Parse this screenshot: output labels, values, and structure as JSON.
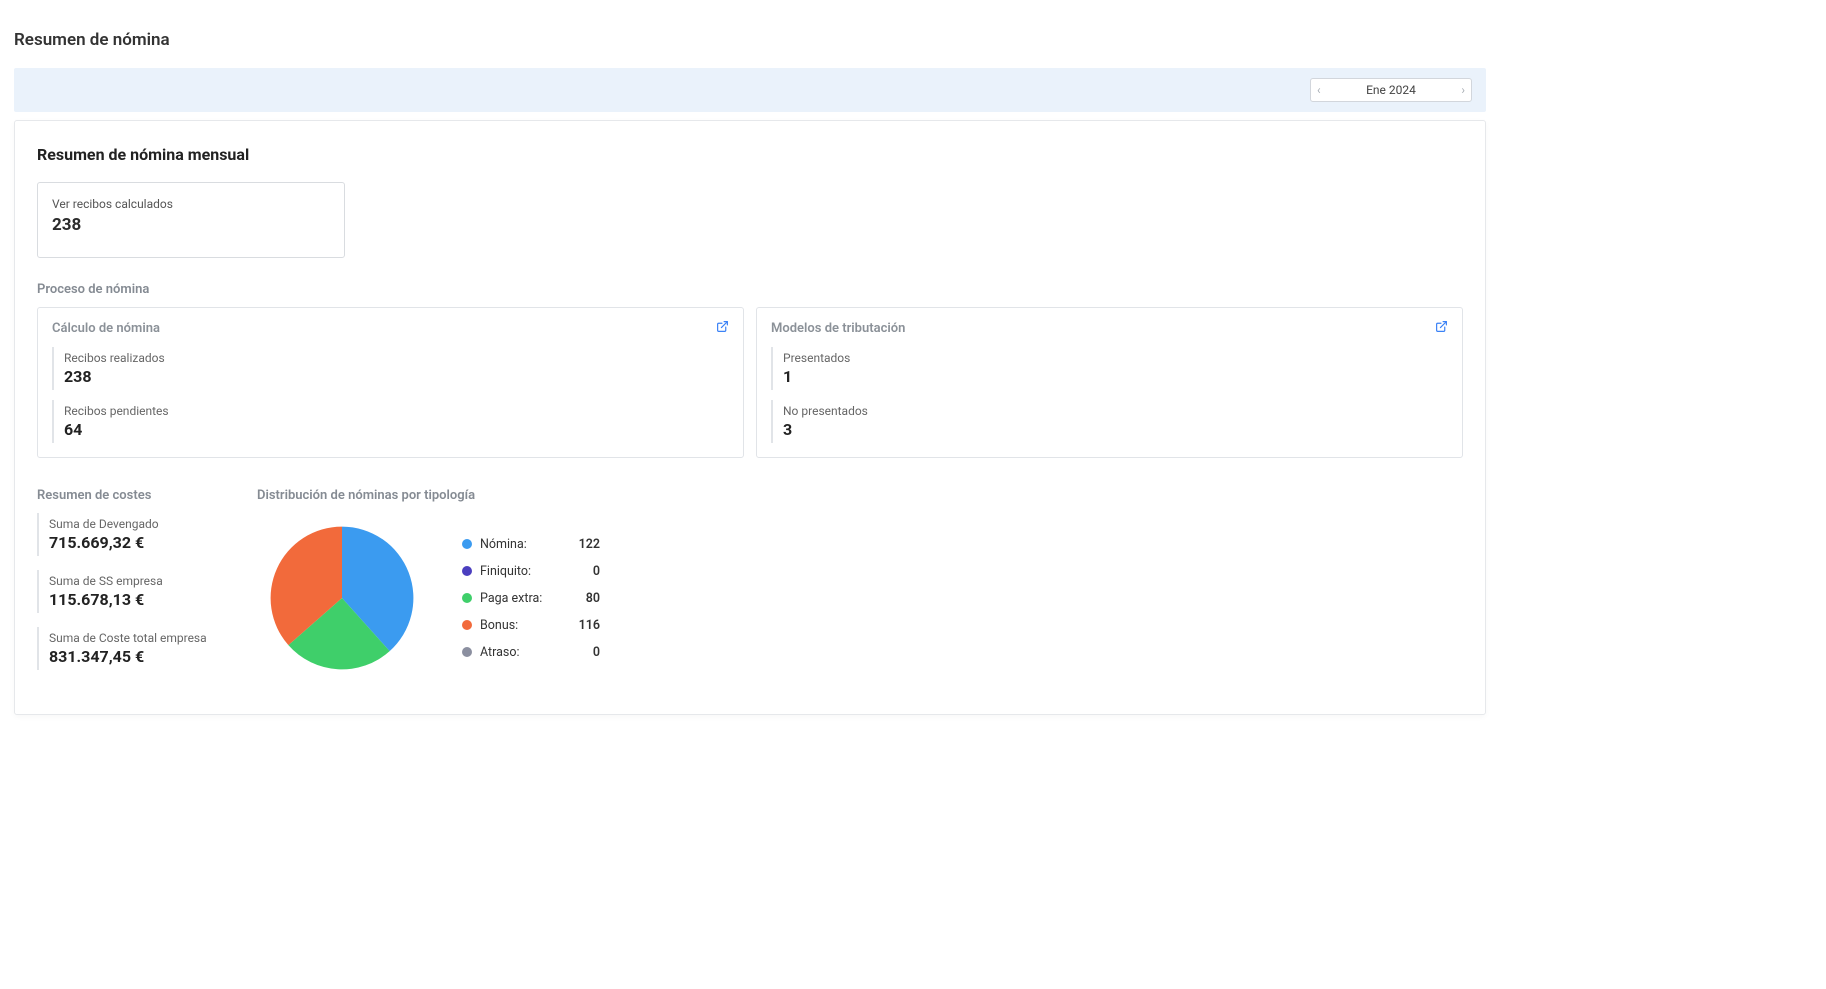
{
  "page_title": "Resumen de nómina",
  "month_picker": {
    "label": "Ene 2024"
  },
  "main": {
    "title": "Resumen de nómina mensual",
    "receipts": {
      "label": "Ver recibos calculados",
      "value": "238"
    },
    "process_title": "Proceso de nómina",
    "calc": {
      "title": "Cálculo de nómina",
      "done": {
        "label": "Recibos realizados",
        "value": "238"
      },
      "pending": {
        "label": "Recibos pendientes",
        "value": "64"
      }
    },
    "tax": {
      "title": "Modelos de tributación",
      "presented": {
        "label": "Presentados",
        "value": "1"
      },
      "not_presented": {
        "label": "No presentados",
        "value": "3"
      }
    },
    "costs_title": "Resumen de costes",
    "costs": {
      "devengado": {
        "label": "Suma de Devengado",
        "value": "715.669,32 €"
      },
      "ss": {
        "label": "Suma de SS empresa",
        "value": "115.678,13 €"
      },
      "total": {
        "label": "Suma de Coste total empresa",
        "value": "831.347,45 €"
      }
    },
    "chart_title": "Distribución de nóminas por tipología"
  },
  "chart_data": {
    "type": "pie",
    "title": "Distribución de nóminas por tipología",
    "series": [
      {
        "name": "Nómina",
        "value": 122,
        "color": "#3b9bf0"
      },
      {
        "name": "Finiquito",
        "value": 0,
        "color": "#4b3fbf"
      },
      {
        "name": "Paga extra",
        "value": 80,
        "color": "#3fcf6a"
      },
      {
        "name": "Bonus",
        "value": 116,
        "color": "#f26a3b"
      },
      {
        "name": "Atraso",
        "value": 0,
        "color": "#8b8fa0"
      }
    ]
  }
}
